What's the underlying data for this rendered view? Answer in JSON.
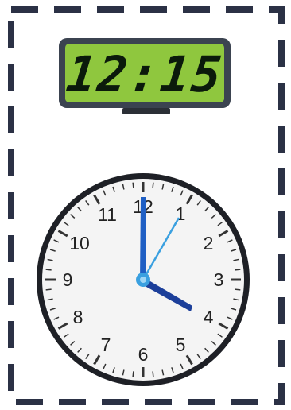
{
  "digital_clock": {
    "time": "12:15"
  },
  "analog_clock": {
    "numerals": [
      "12",
      "1",
      "2",
      "3",
      "4",
      "5",
      "6",
      "7",
      "8",
      "9",
      "10",
      "11"
    ],
    "hour_hand_color": "#1c3f9a",
    "minute_hand_color": "#1f5fc4",
    "second_hand_color": "#3aa0e0"
  },
  "colors": {
    "border_dash": "#2b3145",
    "lcd_background": "#8fc73e",
    "lcd_bezel": "#3b4350"
  }
}
